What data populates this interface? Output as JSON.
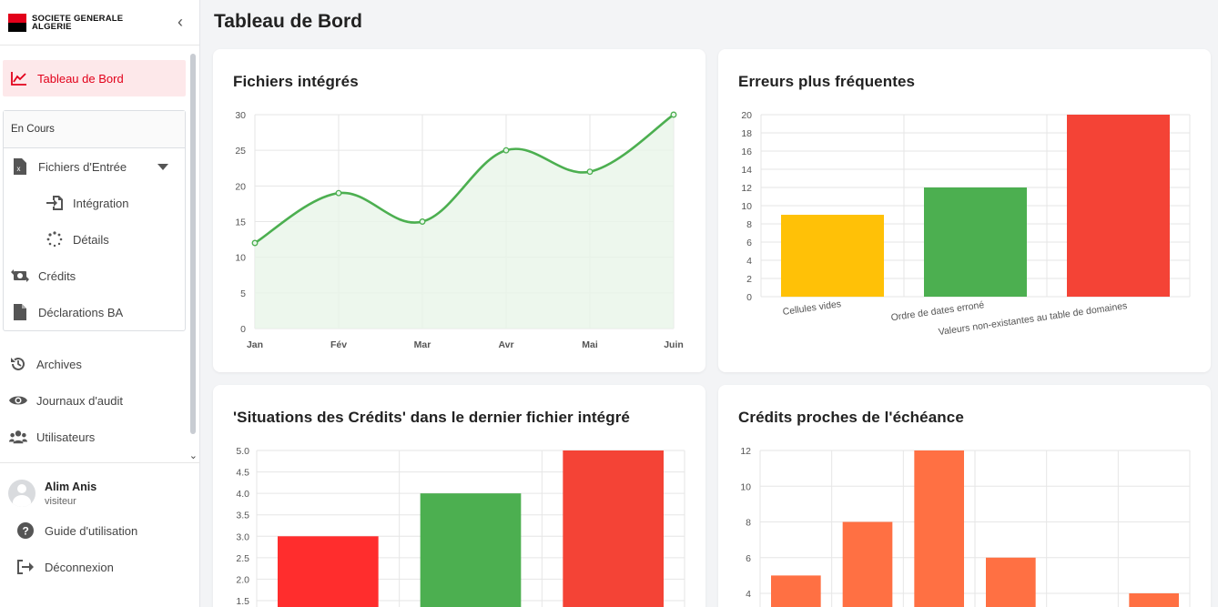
{
  "brand": {
    "line1": "SOCIETE GENERALE",
    "line2": "ALGERIE"
  },
  "sidebar": {
    "active": {
      "label": "Tableau de Bord"
    },
    "group_title": "En Cours",
    "fichiers": "Fichiers d'Entrée",
    "integration": "Intégration",
    "details": "Détails",
    "credits": "Crédits",
    "declarations": "Déclarations BA",
    "archives": "Archives",
    "journaux": "Journaux d'audit",
    "utilisateurs": "Utilisateurs"
  },
  "user": {
    "name": "Alim Anis",
    "role": "visiteur"
  },
  "footer": {
    "guide": "Guide d'utilisation",
    "logout": "Déconnexion"
  },
  "page": {
    "title": "Tableau de Bord"
  },
  "cards": {
    "c1": "Fichiers intégrés",
    "c2": "Erreurs plus fréquentes",
    "c3": "'Situations des Crédits' dans le dernier fichier intégré",
    "c4": "Crédits proches de l'échéance"
  },
  "chart_data": [
    {
      "type": "area",
      "title": "Fichiers intégrés",
      "categories": [
        "Jan",
        "Fév",
        "Mar",
        "Avr",
        "Mai",
        "Juin"
      ],
      "values": [
        12,
        19,
        15,
        25,
        22,
        30
      ],
      "ylim": [
        0,
        30
      ],
      "yticks": [
        0,
        5,
        10,
        15,
        20,
        25,
        30
      ],
      "color": "#4caf50",
      "fill": "#e8f5e9"
    },
    {
      "type": "bar",
      "title": "Erreurs plus fréquentes",
      "categories": [
        "Cellules vides",
        "Ordre de dates erroné",
        "Valeurs non-existantes au table de domaines"
      ],
      "values": [
        9,
        12,
        20
      ],
      "colors": [
        "#ffc107",
        "#4caf50",
        "#f44336"
      ],
      "ylim": [
        0,
        20
      ],
      "yticks": [
        0,
        2,
        4,
        6,
        8,
        10,
        12,
        14,
        16,
        18,
        20
      ]
    },
    {
      "type": "bar",
      "title": "'Situations des Crédits' dans le dernier fichier intégré",
      "values": [
        3,
        4,
        5
      ],
      "colors": [
        "#ff2d2d",
        "#4caf50",
        "#f44336"
      ],
      "ylim": [
        1.5,
        5
      ],
      "yticks": [
        "5.0",
        "4.5",
        "4.0",
        "3.5",
        "3.0",
        "2.5",
        "2.0",
        "1.5"
      ]
    },
    {
      "type": "bar",
      "title": "Crédits proches de l'échéance",
      "values": [
        5,
        8,
        12,
        6,
        0,
        4
      ],
      "color": "#ff7043",
      "ylim": [
        4,
        12
      ],
      "yticks": [
        4,
        6,
        8,
        10,
        12
      ]
    }
  ]
}
